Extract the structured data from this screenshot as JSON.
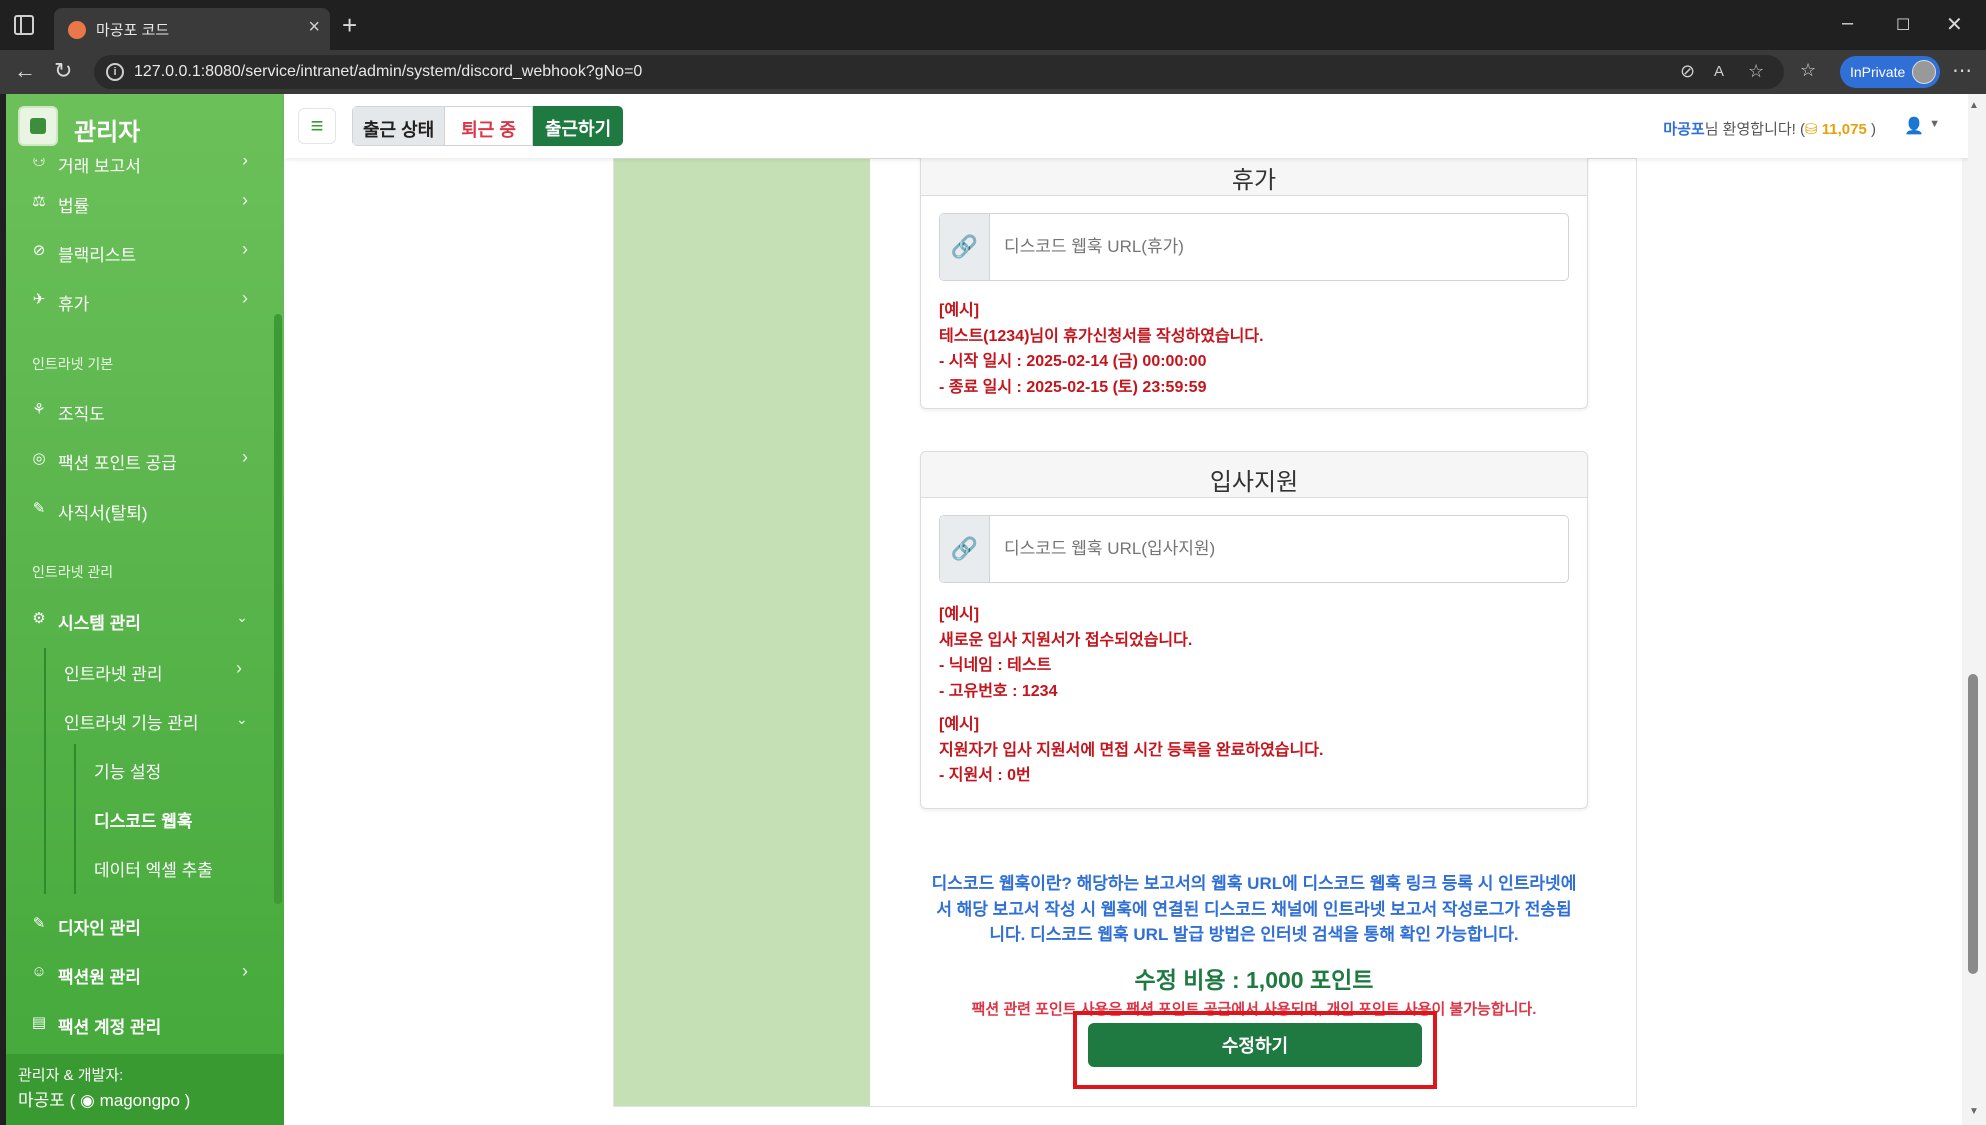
{
  "browser": {
    "tab_title": "마공포 코드",
    "url": "127.0.0.1:8080/service/intranet/admin/system/discord_webhook?gNo=0",
    "inprivate_label": "InPrivate"
  },
  "sidebar": {
    "brand": "관리자",
    "items_top": [
      {
        "label": "거래 보고서",
        "icon": "handshake-icon"
      },
      {
        "label": "법률",
        "icon": "scale-icon"
      },
      {
        "label": "블랙리스트",
        "icon": "ban-icon"
      },
      {
        "label": "휴가",
        "icon": "plane-icon"
      }
    ],
    "section_basic": "인트라넷 기본",
    "items_basic": [
      {
        "label": "조직도",
        "icon": "sitemap-icon"
      },
      {
        "label": "팩션 포인트 공급",
        "icon": "coins-icon"
      },
      {
        "label": "사직서(탈퇴)",
        "icon": "feather-icon"
      }
    ],
    "section_admin": "인트라넷 관리",
    "system_menu": "시스템 관리",
    "sub_intranet": "인트라넷 관리",
    "sub_feature": "인트라넷 기능 관리",
    "sub_sub": [
      "기능 설정",
      "디스코드 웹훅",
      "데이터 엑셀 추출"
    ],
    "items_bottom": [
      {
        "label": "디자인 관리",
        "icon": "pen-icon"
      },
      {
        "label": "팩션원 관리",
        "icon": "user-gear-icon"
      },
      {
        "label": "팩션 계정 관리",
        "icon": "id-card-icon"
      }
    ],
    "credits_line1": "관리자 & 개발자:",
    "credits_line2": "마공포 ( ",
    "credits_discord": "magongpo",
    "credits_end": " )"
  },
  "topbar": {
    "status_label": "출근 상태",
    "status_value": "퇴근 중",
    "checkin_button": "출근하기",
    "welcome_name": "마공포",
    "welcome_text": "님 환영합니다! (",
    "points": "11,075",
    "welcome_end": " )"
  },
  "cards": {
    "vacation": {
      "title": "휴가",
      "placeholder": "디스코드 웹훅 URL(휴가)",
      "example": [
        "[예시]",
        "테스트(1234)님이 휴가신청서를 작성하였습니다.",
        "- 시작 일시 : 2025-02-14 (금) 00:00:00",
        "- 종료 일시 : 2025-02-15 (토) 23:59:59"
      ]
    },
    "apply": {
      "title": "입사지원",
      "placeholder": "디스코드 웹훅 URL(입사지원)",
      "example1": [
        "[예시]",
        "새로운 입사 지원서가 접수되었습니다.",
        "- 닉네임 : 테스트",
        "- 고유번호 : 1234"
      ],
      "example2": [
        "[예시]",
        "지원자가 입사 지원서에 면접 시간 등록을 완료하였습니다.",
        "- 지원서 : 0번"
      ]
    }
  },
  "description": [
    "디스코드 웹훅이란? 해당하는 보고서의 웹훅 URL에 디스코드 웹훅 링크 등록 시 인트라넷에",
    "서 해당 보고서 작성 시 웹훅에 연결된 디스코드 채널에 인트라넷 보고서 작성로그가 전송됩",
    "니다. 디스코드 웹훅 URL 발급 방법은 인터넷 검색을 통해 확인 가능합니다."
  ],
  "cost": "수정 비용 : 1,000 포인트",
  "cost_note": "팩션 관련 포인트 사용은 팩션 포인트 공급에서 사용되며, 개인 포인트 사용이 불가능합니다.",
  "submit_label": "수정하기"
}
